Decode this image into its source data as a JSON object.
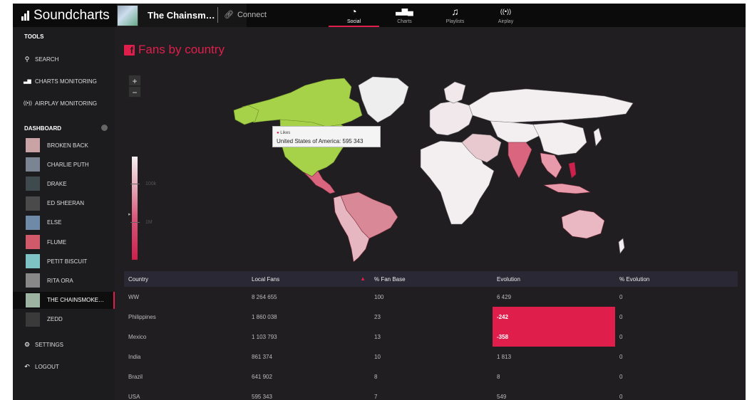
{
  "topbar": {
    "brand": "Soundcharts",
    "artist_title": "The Chainsm…",
    "connect_label": "Connect",
    "tabs": [
      {
        "label": "Social",
        "icon": "pie-chart-icon",
        "active": true
      },
      {
        "label": "Charts",
        "icon": "bar-chart-icon",
        "active": false
      },
      {
        "label": "Playlists",
        "icon": "music-note-icon",
        "active": false
      },
      {
        "label": "Airplay",
        "icon": "radio-waves-icon",
        "active": false
      }
    ]
  },
  "sidebar": {
    "tools_heading": "TOOLS",
    "tools": [
      {
        "label": "SEARCH",
        "icon": "search-icon"
      },
      {
        "label": "CHARTS MONITORING",
        "icon": "bar-chart-icon"
      },
      {
        "label": "AIRPLAY MONITORING",
        "icon": "radio-waves-icon"
      }
    ],
    "dashboard_heading": "DASHBOARD",
    "artists": [
      {
        "label": "BROKEN BACK",
        "color": "#c9a3a6"
      },
      {
        "label": "CHARLIE PUTH",
        "color": "#7b8492"
      },
      {
        "label": "DRAKE",
        "color": "#3e4a4e"
      },
      {
        "label": "ED SHEERAN",
        "color": "#4a4a4a"
      },
      {
        "label": "ELSE",
        "color": "#6f8aa8"
      },
      {
        "label": "FLUME",
        "color": "#d05a6a"
      },
      {
        "label": "PETIT BISCUIT",
        "color": "#7fc2c6"
      },
      {
        "label": "RITA ORA",
        "color": "#888888"
      },
      {
        "label": "THE CHAINSMOKE…",
        "color": "#9bb3a0",
        "active": true
      },
      {
        "label": "ZEDD",
        "color": "#3a3a3a"
      }
    ],
    "settings_label": "SETTINGS",
    "logout_label": "LOGOUT"
  },
  "main": {
    "title": "Fans by country",
    "zoom_in": "+",
    "zoom_out": "−",
    "legend": {
      "label_top": "100k",
      "label_bottom": "1M"
    },
    "tooltip": {
      "series": "Likes",
      "text": "United States of America: 595 343"
    },
    "table": {
      "headers": [
        "Country",
        "Local Fans",
        "% Fan Base",
        "Evolution",
        "% Evolution"
      ],
      "rows": [
        [
          "WW",
          "8 264 655",
          "100",
          "6 429",
          "0"
        ],
        [
          "Philippines",
          "1 860 038",
          "23",
          "-242",
          "0"
        ],
        [
          "Mexico",
          "1 103 793",
          "13",
          "-358",
          "0"
        ],
        [
          "India",
          "861 374",
          "10",
          "1 813",
          "0"
        ],
        [
          "Brazil",
          "641 902",
          "8",
          "8",
          "0"
        ],
        [
          "USA",
          "595 343",
          "7",
          "549",
          "0"
        ]
      ],
      "negative_highlight_color": "#e01e4c"
    }
  },
  "colors": {
    "accent": "#e01e4c",
    "highlight_country": "#a6d24a",
    "background": "#201e21"
  }
}
